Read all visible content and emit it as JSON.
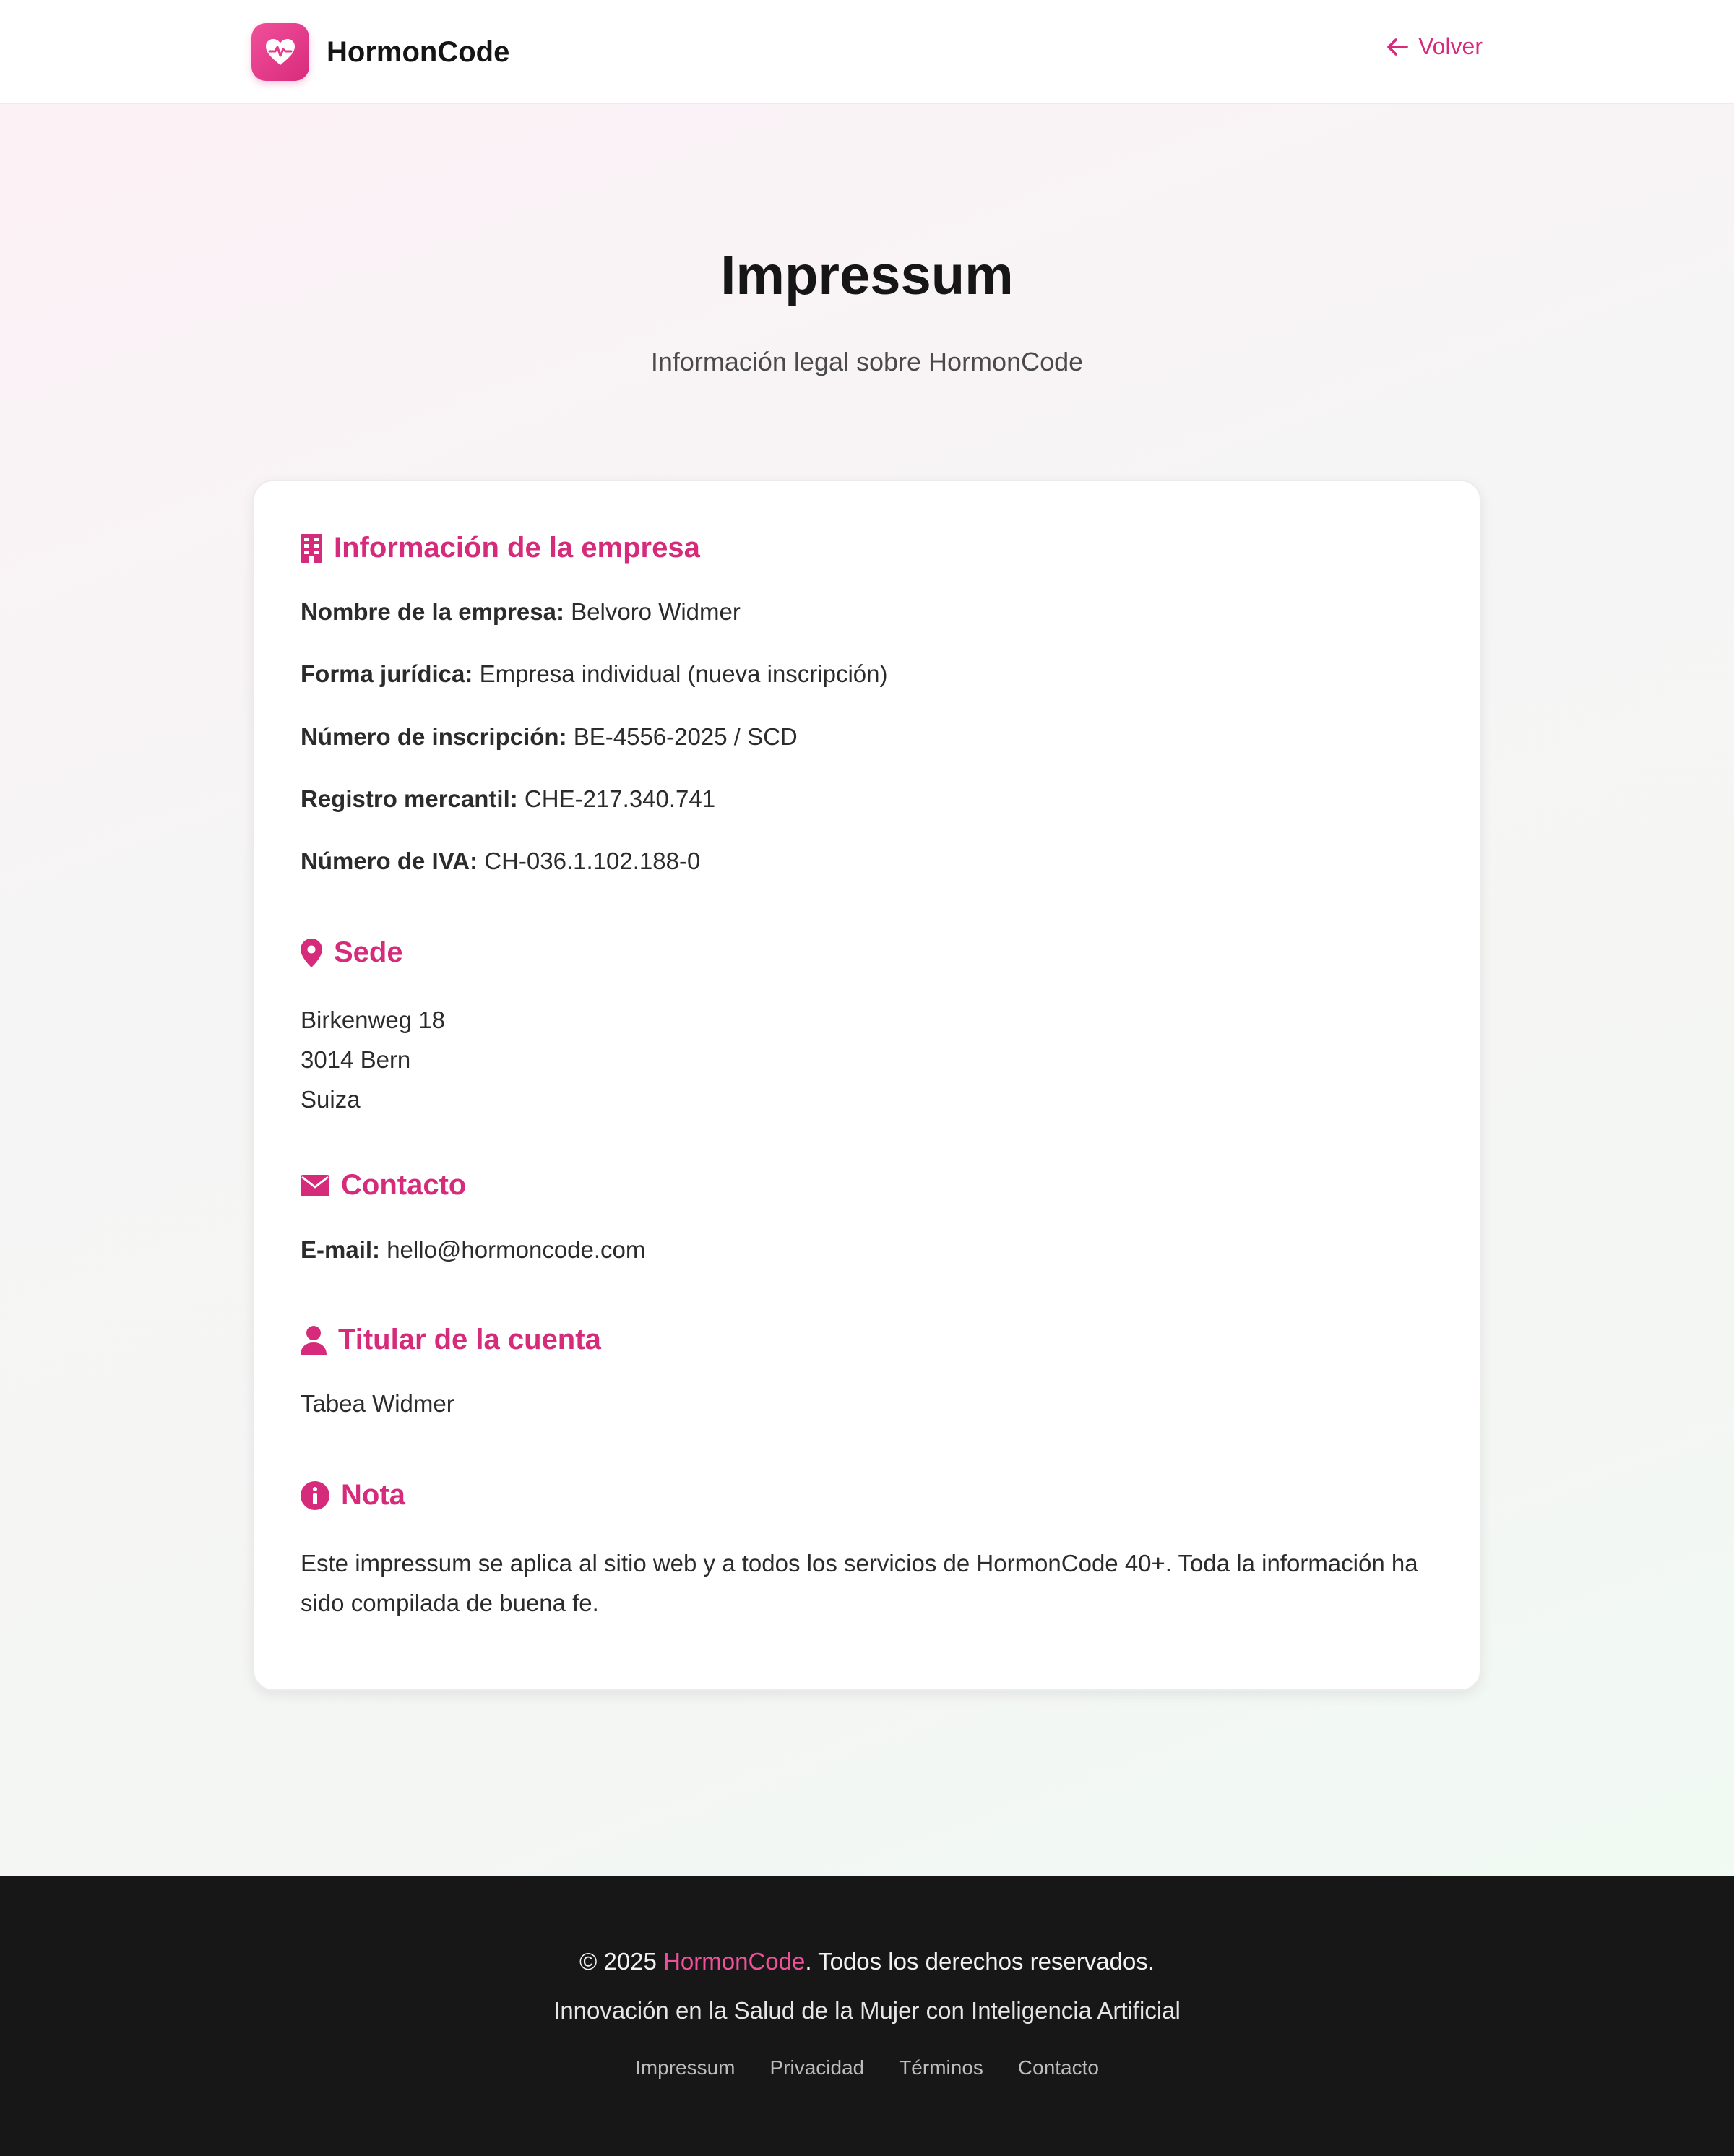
{
  "header": {
    "brand": "HormonCode",
    "back_label": "Volver"
  },
  "hero": {
    "title": "Impressum",
    "subtitle": "Información legal sobre HormonCode"
  },
  "company": {
    "heading": "Información de la empresa",
    "rows": [
      {
        "label": "Nombre de la empresa:",
        "value": "Belvoro Widmer"
      },
      {
        "label": "Forma jurídica:",
        "value": "Empresa individual (nueva inscripción)"
      },
      {
        "label": "Número de inscripción:",
        "value": "BE-4556-2025 / SCD"
      },
      {
        "label": "Registro mercantil:",
        "value": "CHE-217.340.741"
      },
      {
        "label": "Número de IVA:",
        "value": "CH-036.1.102.188-0"
      }
    ]
  },
  "seat": {
    "heading": "Sede",
    "lines": [
      "Birkenweg 18",
      "3014 Bern",
      "Suiza"
    ]
  },
  "contact": {
    "heading": "Contacto",
    "email_label": "E-mail:",
    "email_value": "hello@hormoncode.com"
  },
  "account": {
    "heading": "Titular de la cuenta",
    "name": "Tabea Widmer"
  },
  "note": {
    "heading": "Nota",
    "text": "Este impressum se aplica al sitio web y a todos los servicios de HormonCode 40+. Toda la información ha sido compilada de buena fe."
  },
  "footer": {
    "copy_prefix": "© 2025 ",
    "copy_brand": "HormonCode",
    "copy_suffix": ". Todos los derechos reservados.",
    "tagline": "Innovación en la Salud de la Mujer con Inteligencia Artificial",
    "links": [
      "Impressum",
      "Privacidad",
      "Términos",
      "Contacto"
    ]
  },
  "icons": {
    "logo": "heart-pulse-icon",
    "back": "arrow-left-icon",
    "company": "building-icon",
    "seat": "map-pin-icon",
    "contact": "envelope-icon",
    "account": "user-icon",
    "note": "info-circle-icon"
  },
  "colors": {
    "accent": "#d62a7a",
    "footer_bg": "#171717",
    "footer_brand": "#f0509a"
  }
}
